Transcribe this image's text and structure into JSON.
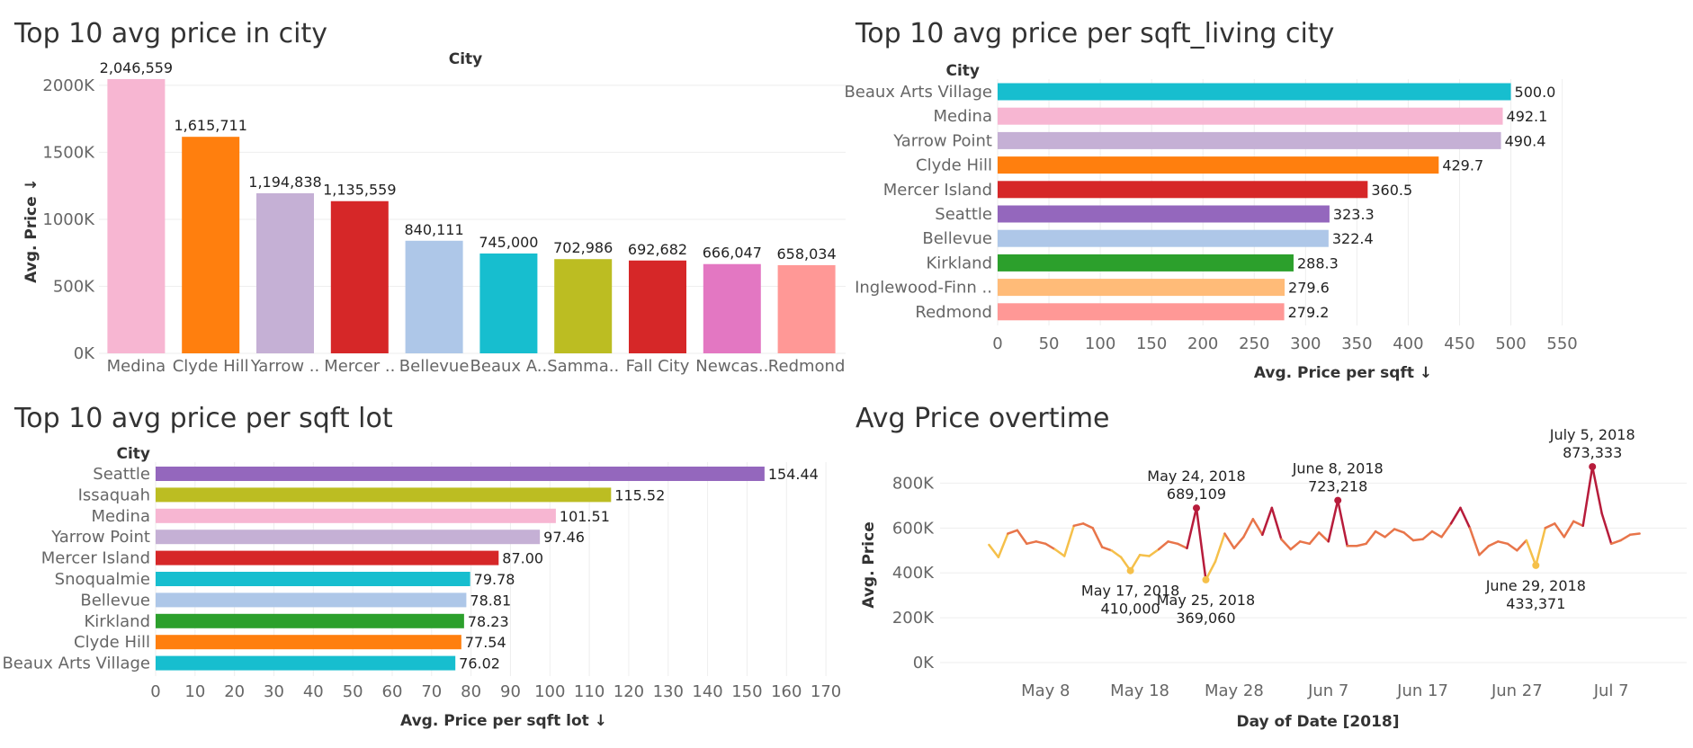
{
  "colors": {
    "medina": "#f7b6d2",
    "clyde_hill": "#ff7f0e",
    "yarrow_point": "#c5b0d5",
    "mercer_island": "#d62728",
    "bellevue": "#aec7e8",
    "beaux_arts": "#17becf",
    "sammamish": "#bcbd22",
    "fall_city": "#d62728",
    "newcastle": "#e377c2",
    "redmond": "#ff9896",
    "seattle": "#9467bd",
    "kirkland": "#2ca02c",
    "inglewood": "#ffbb78",
    "issaquah": "#bcbd22",
    "snoqualmie": "#17becf",
    "line_low": "#f5c04a",
    "line_mid": "#e8754a",
    "line_high": "#b71c3b"
  },
  "chart_data": [
    {
      "type": "bar",
      "title": "Top 10 avg price in city",
      "xlabel": "City",
      "ylabel": "Avg. Price",
      "ylim": [
        0,
        2100000
      ],
      "yticks": [
        "0K",
        "500K",
        "1000K",
        "1500K",
        "2000K"
      ],
      "ytick_values": [
        0,
        500000,
        1000000,
        1500000,
        2000000
      ],
      "categories": [
        "Medina",
        "Clyde Hill",
        "Yarrow ..",
        "Mercer ..",
        "Bellevue",
        "Beaux A..",
        "Samma..",
        "Fall City",
        "Newcas..",
        "Redmond"
      ],
      "values": [
        2046559,
        1615711,
        1194838,
        1135559,
        840111,
        745000,
        702986,
        692682,
        666047,
        658034
      ],
      "data_labels": [
        "2,046,559",
        "1,615,711",
        "1,194,838",
        "1,135,559",
        "840,111",
        "745,000",
        "702,986",
        "692,682",
        "666,047",
        "658,034"
      ],
      "color_keys": [
        "medina",
        "clyde_hill",
        "yarrow_point",
        "mercer_island",
        "bellevue",
        "beaux_arts",
        "sammamish",
        "fall_city",
        "newcastle",
        "redmond"
      ],
      "grid": true
    },
    {
      "type": "bar",
      "orientation": "horizontal",
      "title": "Top 10 avg price per sqft_living city",
      "ylabel": "City",
      "xlabel": "Avg. Price per sqft",
      "xlim": [
        0,
        560
      ],
      "xticks": [
        0,
        50,
        100,
        150,
        200,
        250,
        300,
        350,
        400,
        450,
        500,
        550
      ],
      "categories": [
        "Beaux Arts Village",
        "Medina",
        "Yarrow Point",
        "Clyde Hill",
        "Mercer Island",
        "Seattle",
        "Bellevue",
        "Kirkland",
        "Inglewood-Finn ..",
        "Redmond"
      ],
      "values": [
        500.0,
        492.1,
        490.4,
        429.7,
        360.5,
        323.3,
        322.4,
        288.3,
        279.6,
        279.2
      ],
      "data_labels": [
        "500.0",
        "492.1",
        "490.4",
        "429.7",
        "360.5",
        "323.3",
        "322.4",
        "288.3",
        "279.6",
        "279.2"
      ],
      "color_keys": [
        "beaux_arts",
        "medina",
        "yarrow_point",
        "clyde_hill",
        "mercer_island",
        "seattle",
        "bellevue",
        "kirkland",
        "inglewood",
        "redmond"
      ],
      "grid": true
    },
    {
      "type": "bar",
      "orientation": "horizontal",
      "title": "Top 10 avg price per sqft lot",
      "ylabel": "City",
      "xlabel": "Avg. Price per sqft lot",
      "xlim": [
        0,
        175
      ],
      "xticks": [
        0,
        10,
        20,
        30,
        40,
        50,
        60,
        70,
        80,
        90,
        100,
        110,
        120,
        130,
        140,
        150,
        160,
        170
      ],
      "categories": [
        "Seattle",
        "Issaquah",
        "Medina",
        "Yarrow Point",
        "Mercer Island",
        "Snoqualmie",
        "Bellevue",
        "Kirkland",
        "Clyde Hill",
        "Beaux Arts Village"
      ],
      "values": [
        154.44,
        115.52,
        101.51,
        97.46,
        87.0,
        79.78,
        78.81,
        78.23,
        77.54,
        76.02
      ],
      "data_labels": [
        "154.44",
        "115.52",
        "101.51",
        "97.46",
        "87.00",
        "79.78",
        "78.81",
        "78.23",
        "77.54",
        "76.02"
      ],
      "color_keys": [
        "seattle",
        "issaquah",
        "medina",
        "yarrow_point",
        "mercer_island",
        "snoqualmie",
        "bellevue",
        "kirkland",
        "clyde_hill",
        "beaux_arts"
      ],
      "grid": true
    },
    {
      "type": "line",
      "title": "Avg Price overtime",
      "xlabel": "Day of Date [2018]",
      "ylabel": "Avg. Price",
      "ylim": [
        0,
        950000
      ],
      "yticks": [
        "0K",
        "200K",
        "400K",
        "600K",
        "800K"
      ],
      "ytick_values": [
        0,
        200000,
        400000,
        600000,
        800000
      ],
      "xlim": [
        "2018-04-27",
        "2018-07-15"
      ],
      "xticks": [
        "May 8",
        "May 18",
        "May 28",
        "Jun 7",
        "Jun 17",
        "Jun 27",
        "Jul 7"
      ],
      "xtick_dates": [
        "2018-05-08",
        "2018-05-18",
        "2018-05-28",
        "2018-06-07",
        "2018-06-17",
        "2018-06-27",
        "2018-07-07"
      ],
      "start_date": "2018-05-02",
      "values": [
        525000,
        470000,
        575000,
        590000,
        530000,
        540000,
        530000,
        505000,
        475000,
        610000,
        620000,
        600000,
        515000,
        500000,
        470000,
        410000,
        480000,
        475000,
        505000,
        540000,
        530000,
        510000,
        689109,
        369060,
        450000,
        575000,
        510000,
        560000,
        640000,
        570000,
        690000,
        550000,
        505000,
        540000,
        530000,
        580000,
        540000,
        723218,
        520000,
        520000,
        530000,
        585000,
        560000,
        595000,
        580000,
        545000,
        550000,
        585000,
        560000,
        620000,
        690000,
        600000,
        480000,
        520000,
        540000,
        530000,
        500000,
        545000,
        433371,
        600000,
        620000,
        560000,
        630000,
        610000,
        873333,
        665000,
        530000,
        545000,
        570000,
        575000
      ],
      "annotations": [
        {
          "date": "May 24, 2018",
          "value": "689,109",
          "index": 22,
          "pos": "above"
        },
        {
          "date": "June 8, 2018",
          "value": "723,218",
          "index": 37,
          "pos": "above"
        },
        {
          "date": "July 5, 2018",
          "value": "873,333",
          "index": 64,
          "pos": "above"
        },
        {
          "date": "May 17, 2018",
          "value": "410,000",
          "index": 15,
          "pos": "below"
        },
        {
          "date": "May 25, 2018",
          "value": "369,060",
          "index": 23,
          "pos": "below"
        },
        {
          "date": "June 29, 2018",
          "value": "433,371",
          "index": 58,
          "pos": "below"
        }
      ],
      "grid": true
    }
  ]
}
